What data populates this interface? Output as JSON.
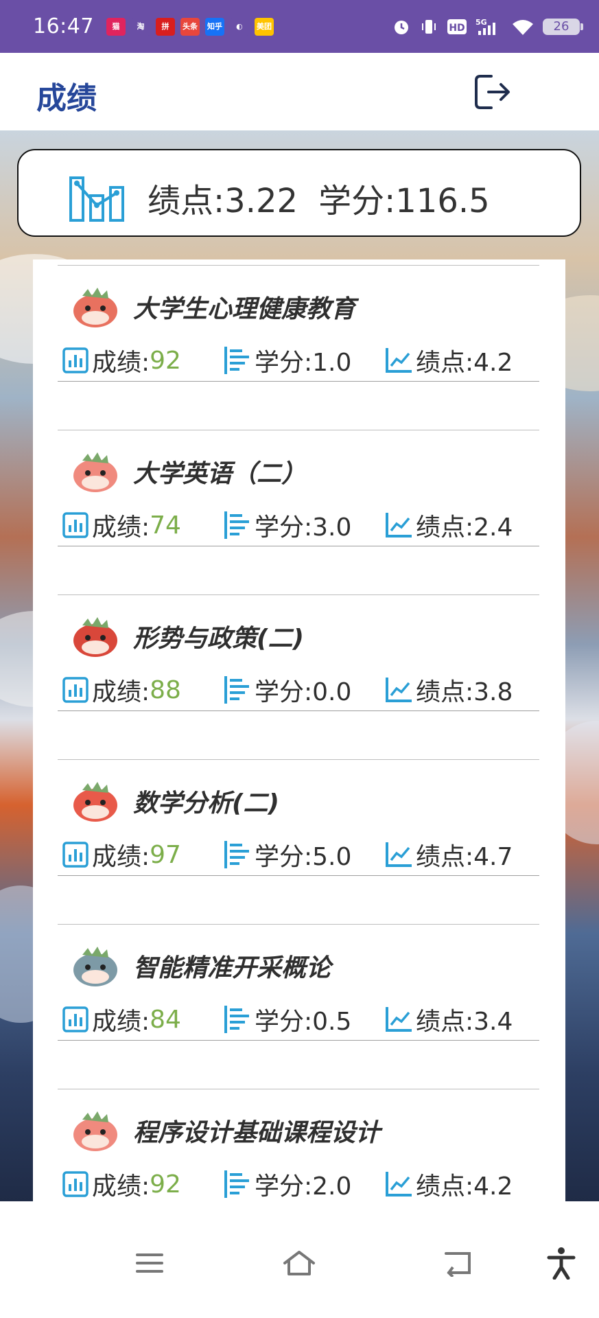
{
  "status_bar": {
    "time": "16:47",
    "notifications": [
      {
        "label": "猫",
        "color": "#e0245e"
      },
      {
        "label": "淘",
        "color": "#6a4fa6"
      },
      {
        "label": "拼",
        "color": "#d81e1e"
      },
      {
        "label": "头条",
        "color": "#e8463c"
      },
      {
        "label": "知乎",
        "color": "#1772f6"
      },
      {
        "label": "◐",
        "color": "#6a4fa6"
      },
      {
        "label": "美团",
        "color": "#ffc300"
      }
    ],
    "network": "5G",
    "hd": "HD",
    "battery": "26"
  },
  "header": {
    "title": "成绩",
    "logout_icon": "logout-icon"
  },
  "summary": {
    "gpa_text": "绩点:3.22",
    "credit_text": "学分:116.5",
    "icon": "chart-icon"
  },
  "courses": [
    {
      "name": "大学生心理健康教育",
      "score_label": "成绩:",
      "score": "92",
      "credit": "学分:1.0",
      "gpa": "绩点:4.2",
      "avatar_color": "#e8715f"
    },
    {
      "name": "大学英语（二）",
      "score_label": "成绩:",
      "score": "74",
      "credit": "学分:3.0",
      "gpa": "绩点:2.4",
      "avatar_color": "#f08a7e"
    },
    {
      "name": "形势与政策(二)",
      "score_label": "成绩:",
      "score": "88",
      "credit": "学分:0.0",
      "gpa": "绩点:3.8",
      "avatar_color": "#d9473a"
    },
    {
      "name": "数学分析(二)",
      "score_label": "成绩:",
      "score": "97",
      "credit": "学分:5.0",
      "gpa": "绩点:4.7",
      "avatar_color": "#e85a4a"
    },
    {
      "name": "智能精准开采概论",
      "score_label": "成绩:",
      "score": "84",
      "credit": "学分:0.5",
      "gpa": "绩点:3.4",
      "avatar_color": "#7d9aa6"
    },
    {
      "name": "程序设计基础课程设计",
      "score_label": "成绩:",
      "score": "92",
      "credit": "学分:2.0",
      "gpa": "绩点:4.2",
      "avatar_color": "#f08a7e"
    }
  ],
  "colors": {
    "accent_blue": "#2a9fd6",
    "title_blue": "#26479a",
    "score_green": "#7cae4a",
    "status_purple": "#6a4fa6"
  },
  "nav": {
    "menu_icon": "menu-icon",
    "home_icon": "home-icon",
    "back_icon": "back-icon",
    "accessibility_icon": "accessibility-icon"
  }
}
